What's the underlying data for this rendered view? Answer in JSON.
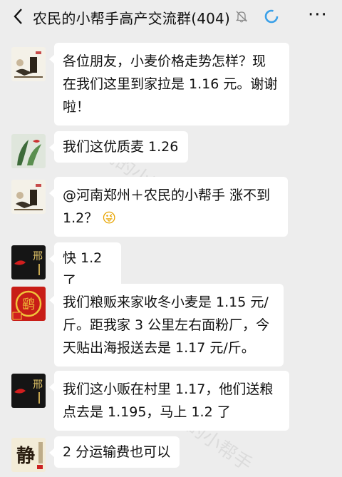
{
  "header": {
    "back_icon": "chevron-left-icon",
    "title": "农民的小帮手高产交流群(404)",
    "mute_icon": "bell-muted-icon",
    "sync_icon": "loading-circle-icon",
    "more_label": "···"
  },
  "watermark": {
    "line1": "农民的小帮手",
    "line2": "农民的小帮手"
  },
  "messages": [
    {
      "avatar": "tea-sketch-avatar",
      "lines": [
        "各位朋友，小麦价格走势怎样？现",
        "在我们这里到家拉是 1.16 元。谢谢",
        "啦！"
      ]
    },
    {
      "avatar": "green-plant-avatar",
      "lines": [
        "我们这优质麦 1.26"
      ]
    },
    {
      "avatar": "tea-sketch-avatar",
      "lines": [
        "@河南郑州＋农民的小帮手  涨不到",
        "1.2？"
      ],
      "emoji": "😜"
    },
    {
      "avatar": "red-flag-xing-avatar",
      "lines": [
        "快 1.2 了"
      ]
    },
    {
      "avatar": "red-seal-avatar",
      "lines": [
        "我们粮贩来家收冬小麦是 1.15 元/",
        "斤。距我家 3 公里左右面粉厂，今",
        "天贴出海报送去是 1.17 元/斤。"
      ]
    },
    {
      "avatar": "red-flag-xing-avatar",
      "lines": [
        "我们这小贩在村里 1.17，他们送粮",
        "点去是 1.195，马上 1.2 了"
      ]
    },
    {
      "avatar": "jing-calligraphy-avatar",
      "lines": [
        "2 分运输费也可以"
      ]
    }
  ],
  "colors": {
    "background": "#ededed",
    "bubble": "#ffffff",
    "sync_blue": "#3aa0e8"
  }
}
